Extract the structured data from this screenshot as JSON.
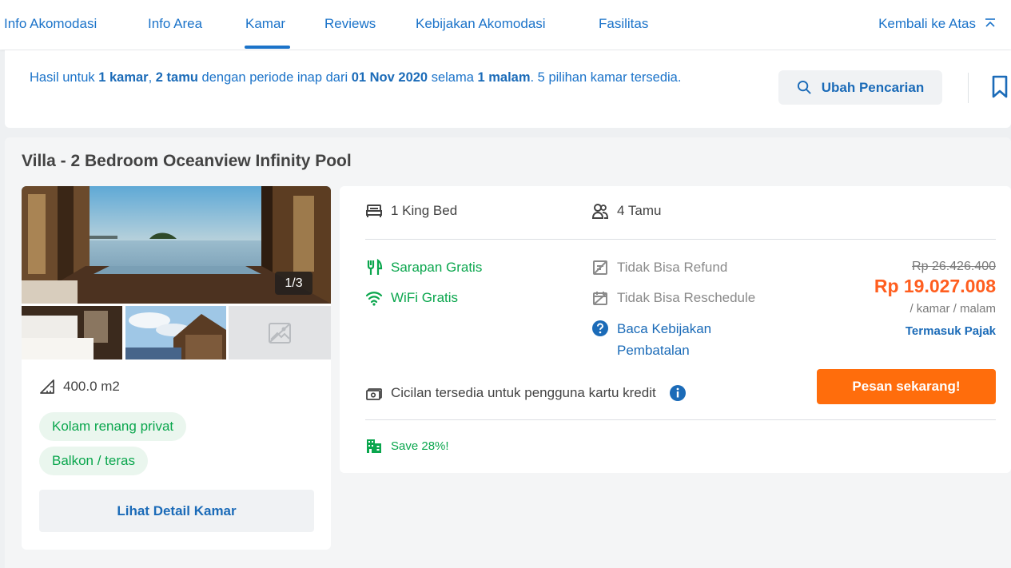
{
  "nav": {
    "tabs": [
      {
        "label": "Info Akomodasi"
      },
      {
        "label": "Info Area"
      },
      {
        "label": "Kamar"
      },
      {
        "label": "Reviews"
      },
      {
        "label": "Kebijakan Akomodasi"
      },
      {
        "label": "Fasilitas"
      }
    ],
    "active_tab": "Kamar",
    "back_to_top": "Kembali ke Atas"
  },
  "summary": {
    "p1": "Hasil untuk ",
    "rooms": "1 kamar",
    "p2": ", ",
    "guests": "2 tamu",
    "p3": " dengan periode inap dari ",
    "date": "01 Nov 2020",
    "p4": " selama ",
    "nights": "1 malam",
    "p5": ". 5 pilihan kamar tersedia.",
    "change_search": "Ubah Pencarian"
  },
  "room": {
    "title": "Villa - 2 Bedroom Oceanview Infinity Pool",
    "photo_count": "1/3",
    "size": "400.0 m2",
    "amenities": [
      "Kolam renang privat",
      "Balkon / teras"
    ],
    "detail_button": "Lihat Detail Kamar",
    "bed": "1 King Bed",
    "guests": "4 Tamu",
    "breakfast": "Sarapan Gratis",
    "wifi": "WiFi Gratis",
    "refund": "Tidak Bisa Refund",
    "reschedule": "Tidak Bisa Reschedule",
    "cancel_policy": "Baca Kebijakan Pembatalan",
    "price_original": "Rp 26.426.400",
    "price_final": "Rp 19.027.008",
    "price_unit": "/ kamar / malam",
    "tax_note": "Termasuk Pajak",
    "installment": "Cicilan tersedia untuk pengguna kartu kredit",
    "book_button": "Pesan sekarang!",
    "save_text": "Save 28%!"
  },
  "colors": {
    "accent_blue": "#1b73c9",
    "green": "#0aa64d",
    "orange": "#ff6d0c",
    "price_orange": "#ff5e1f"
  },
  "icons": [
    "chevron-up-icon",
    "search-icon",
    "bookmark-icon",
    "bed-icon",
    "guests-icon",
    "fork-icon",
    "wifi-icon",
    "no-refund-icon",
    "no-reschedule-icon",
    "question-icon",
    "room-size-icon",
    "credit-card-icon",
    "info-icon",
    "building-icon",
    "image-placeholder-icon"
  ]
}
